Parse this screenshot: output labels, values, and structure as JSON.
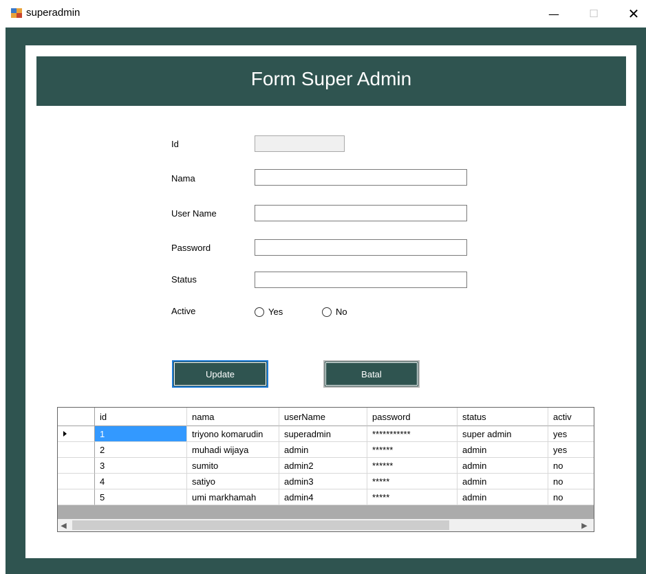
{
  "window": {
    "title": "superadmin",
    "minimize_glyph": "—",
    "maximize_glyph": "☐",
    "close_glyph": "✕"
  },
  "header": {
    "title": "Form Super Admin"
  },
  "form": {
    "id_label": "Id",
    "id_value": "",
    "nama_label": "Nama",
    "nama_value": "",
    "username_label": "User Name",
    "username_value": "",
    "password_label": "Password",
    "password_value": "",
    "status_label": "Status",
    "status_value": "",
    "active_label": "Active",
    "active_options": [
      "Yes",
      "No"
    ]
  },
  "buttons": {
    "update": "Update",
    "batal": "Batal"
  },
  "grid": {
    "columns": [
      "id",
      "nama",
      "userName",
      "password",
      "status",
      "activ"
    ],
    "rows": [
      [
        "1",
        "triyono komarudin",
        "superadmin",
        "***********",
        "super admin",
        "yes"
      ],
      [
        "2",
        "muhadi wijaya",
        "admin",
        "******",
        "admin",
        "yes"
      ],
      [
        "3",
        "sumito",
        "admin2",
        "******",
        "admin",
        "no"
      ],
      [
        "4",
        "satiyo",
        "admin3",
        "*****",
        "admin",
        "no"
      ],
      [
        "5",
        "umi markhamah",
        "admin4",
        "*****",
        "admin",
        "no"
      ]
    ],
    "selected_row": 0,
    "scroll_up_glyph": "▲",
    "scroll_down_glyph": "▼",
    "scroll_left_glyph": "◀",
    "scroll_right_glyph": "▶"
  },
  "colors": {
    "accent": "#2f5450",
    "selection": "#3399ff",
    "focus_border": "#1c7ad6"
  }
}
